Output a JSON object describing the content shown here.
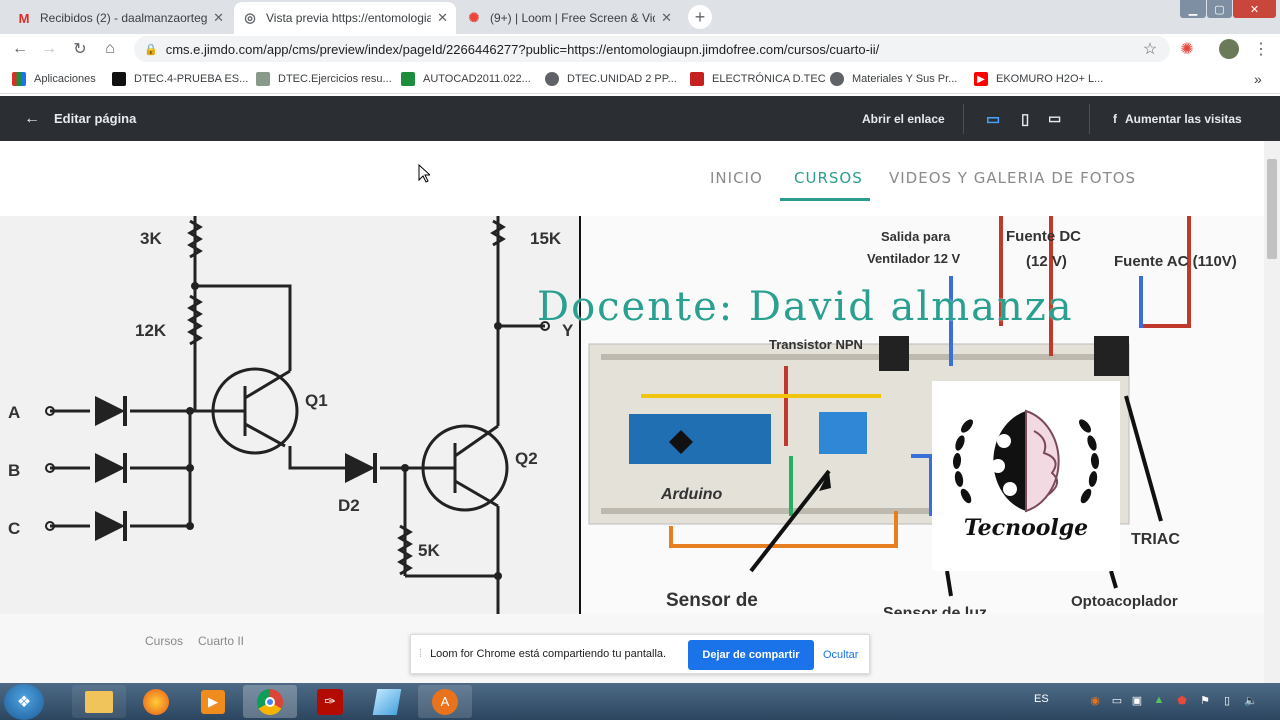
{
  "browser": {
    "tabs": [
      {
        "icon": "gmail-icon",
        "title": "Recibidos (2) - daalmanzaortega@",
        "active": false
      },
      {
        "icon": "globe-icon",
        "title": "Vista previa https://entomologia",
        "active": true
      },
      {
        "icon": "loom-icon",
        "title": "(9+) | Loom | Free Screen & Vide",
        "active": false
      }
    ],
    "new_tab": "+",
    "address": "cms.e.jimdo.com/app/cms/preview/index/pageId/2266446277?public=https://entomologiaupn.jimdofree.com/cursos/cuarto-ii/",
    "bookmarks": [
      {
        "label": "Aplicaciones",
        "color": "#d93025"
      },
      {
        "label": "DTEC.4-PRUEBA ES...",
        "color": "#111111"
      },
      {
        "label": "DTEC.Ejercicios resu...",
        "color": "#8a9a8a"
      },
      {
        "label": "AUTOCAD2011.022...",
        "color": "#1e8e3e"
      },
      {
        "label": "DTEC.UNIDAD 2 PP...",
        "color": "#5f6368"
      },
      {
        "label": "ELECTRÓNICA D.TEC",
        "color": "#c5221f"
      },
      {
        "label": "Materiales Y Sus Pr...",
        "color": "#5f6368"
      },
      {
        "label": "EKOMURO H2O+ L...",
        "color": "#ff0000"
      }
    ],
    "more": "»"
  },
  "jimdo": {
    "back_label": "Editar página",
    "open_link": "Abrir el enlace",
    "boost": "Aumentar las visitas",
    "fb": "f"
  },
  "site": {
    "nav": [
      {
        "label": "INICIO",
        "active": false
      },
      {
        "label": "CURSOS",
        "active": true
      },
      {
        "label": "VIDEOS Y GALERIA DE FOTOS",
        "active": false
      }
    ],
    "hero_title": "Docente: David almanza",
    "logo_text": "Tecnoolge",
    "schematic_labels": {
      "r1": "3K",
      "r2": "12K",
      "r3": "15K",
      "r4": "5K",
      "q1": "Q1",
      "q2": "Q2",
      "d2": "D2",
      "a": "A",
      "b": "B",
      "c": "C",
      "y": "Y"
    },
    "breadboard_labels": {
      "salida": "Salida para Ventilador 12 V",
      "fuente_dc": "Fuente DC (12 V)",
      "fuente_ac": "Fuente AC (110V)",
      "transistor": "Transistor NPN",
      "arduino": "Arduino",
      "triac": "TRIAC",
      "sensor": "Sensor de",
      "sensor_luz": "Sensor de luz",
      "opto": "Optoacoplador"
    },
    "breadcrumb": [
      "Cursos",
      "Cuarto II"
    ]
  },
  "loom": {
    "message": "Loom for Chrome está compartiendo tu pantalla.",
    "stop": "Dejar de compartir",
    "hide": "Ocultar"
  },
  "taskbar": {
    "lang": "ES"
  }
}
